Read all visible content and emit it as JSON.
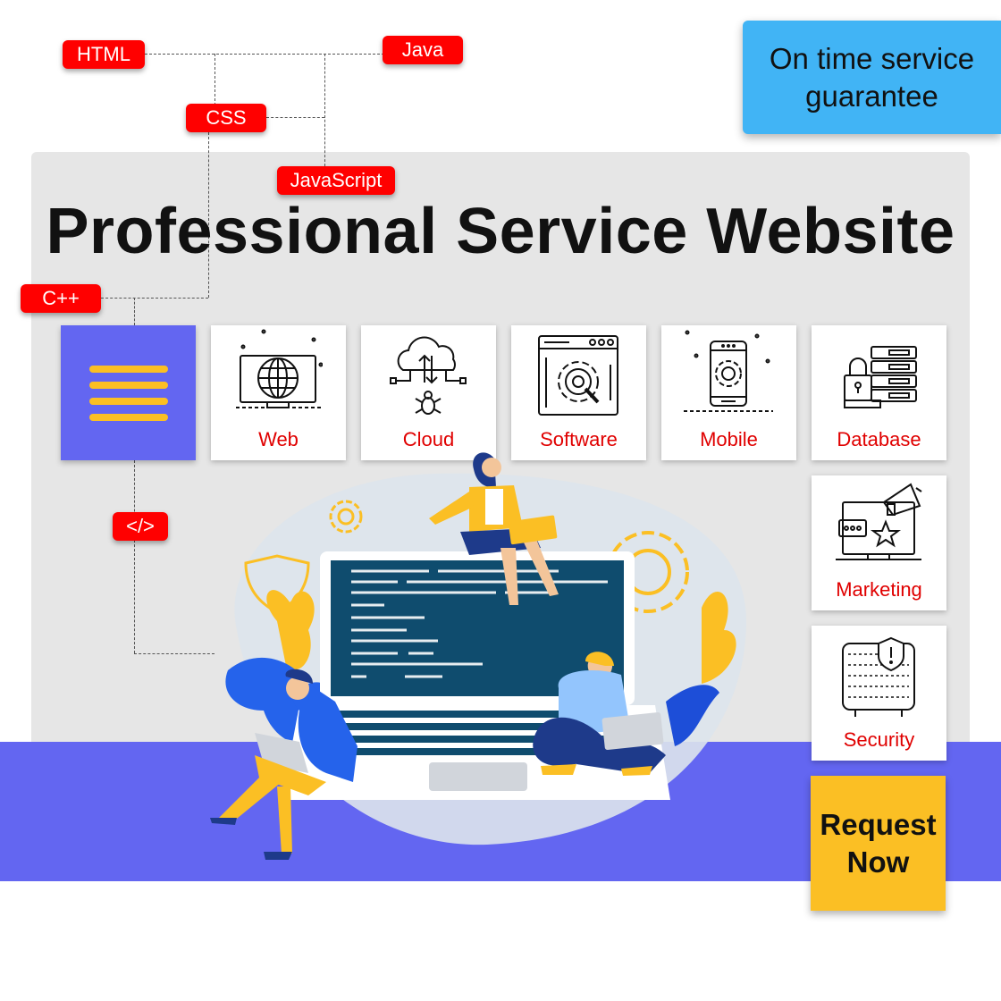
{
  "hero": {
    "title": "Professional Service Website"
  },
  "guarantee": {
    "text_line1": "On time service",
    "text_line2": "guarantee"
  },
  "tags": {
    "html": "HTML",
    "java": "Java",
    "css": "CSS",
    "javascript": "JavaScript",
    "cpp": "C++",
    "code": "</>"
  },
  "services": [
    {
      "label": "Web",
      "icon": "globe-monitor-icon"
    },
    {
      "label": "Cloud",
      "icon": "cloud-network-icon"
    },
    {
      "label": "Software",
      "icon": "software-gear-icon"
    },
    {
      "label": "Mobile",
      "icon": "mobile-gear-icon"
    },
    {
      "label": "Database",
      "icon": "database-lock-icon"
    },
    {
      "label": "Marketing",
      "icon": "megaphone-laptop-icon"
    },
    {
      "label": "Security",
      "icon": "binary-shield-icon"
    }
  ],
  "cta": {
    "line1": "Request",
    "line2": "Now"
  },
  "colors": {
    "tag_red": "#ff0000",
    "label_red": "#e00000",
    "accent_indigo": "#6366f1",
    "accent_yellow": "#fbbf24",
    "accent_blue": "#41b4f5",
    "panel_gray": "#e6e6e6",
    "screen_navy": "#0f4c6e"
  }
}
